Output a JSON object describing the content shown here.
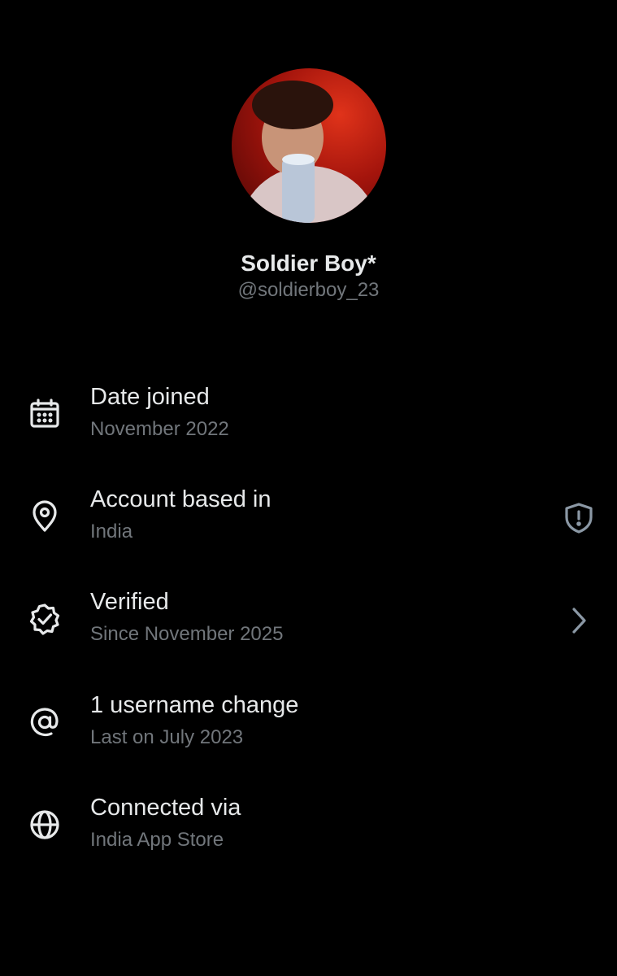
{
  "profile": {
    "display_name": "Soldier Boy*",
    "handle": "@soldierboy_23"
  },
  "details": [
    {
      "title": "Date joined",
      "subtitle": "November 2022",
      "icon": "calendar-icon"
    },
    {
      "title": "Account based in",
      "subtitle": "India",
      "icon": "location-pin-icon",
      "trailing_icon": "shield-alert-icon"
    },
    {
      "title": "Verified",
      "subtitle": "Since November 2025",
      "icon": "verified-badge-icon",
      "trailing_icon": "chevron-right-icon"
    },
    {
      "title": "1 username change",
      "subtitle": "Last on July 2023",
      "icon": "at-sign-icon"
    },
    {
      "title": "Connected via",
      "subtitle": "India App Store",
      "icon": "globe-icon"
    }
  ],
  "colors": {
    "background": "#000000",
    "primary_text": "#e7e9ea",
    "secondary_text": "#71767b",
    "icon": "#e7e9ea",
    "trailing_icon": "#8b98a5"
  }
}
